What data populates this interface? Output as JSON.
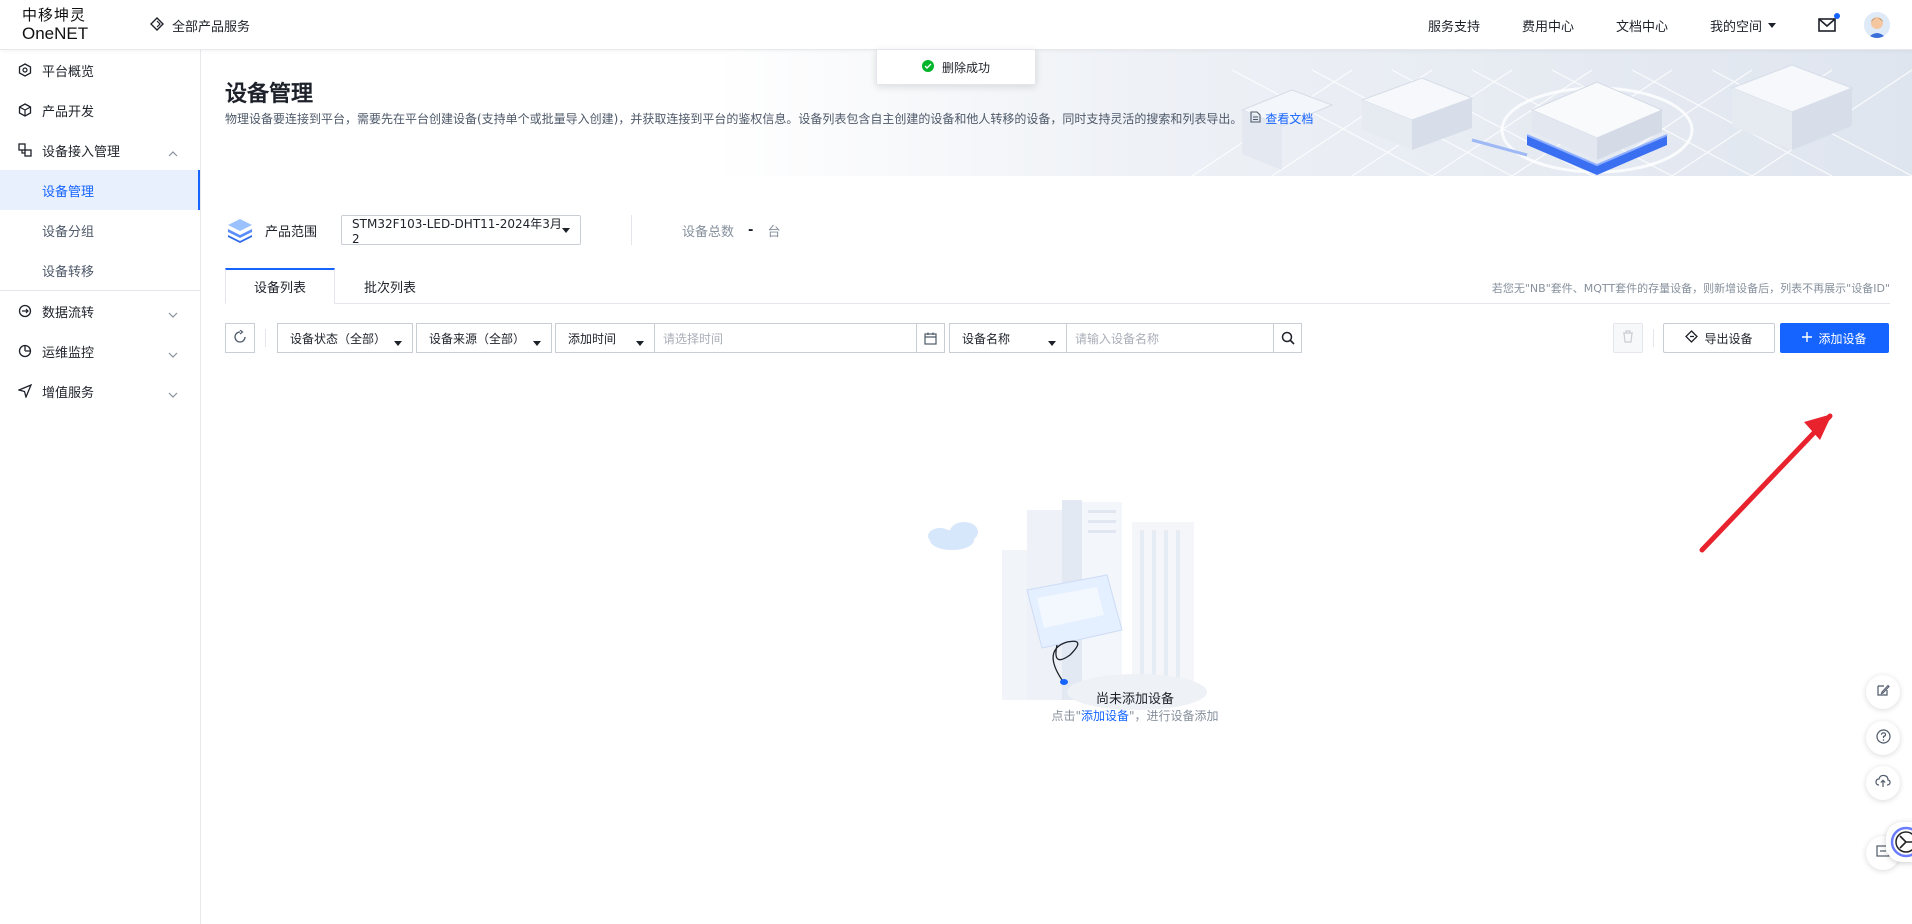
{
  "header": {
    "logo_line1": "中移坤灵",
    "logo_line2": "OneNET",
    "all_products": "全部产品服务",
    "links": [
      "服务支持",
      "费用中心",
      "文档中心"
    ],
    "my_space": "我的空间"
  },
  "sidebar": {
    "items": [
      {
        "label": "平台概览",
        "icon": "overview-icon"
      },
      {
        "label": "产品开发",
        "icon": "box-icon"
      },
      {
        "label": "设备接入管理",
        "icon": "device-access-icon"
      },
      {
        "label": "数据流转",
        "icon": "data-flow-icon"
      },
      {
        "label": "运维监控",
        "icon": "monitor-icon"
      },
      {
        "label": "增值服务",
        "icon": "send-icon"
      }
    ],
    "sub_items": [
      "设备管理",
      "设备分组",
      "设备转移"
    ]
  },
  "toast": {
    "text": "删除成功",
    "status_color": "#00b42a"
  },
  "hero": {
    "title": "设备管理",
    "description": "物理设备要连接到平台，需要先在平台创建设备(支持单个或批量导入创建)，并获取连接到平台的鉴权信息。设备列表包含自主创建的设备和他人转移的设备，同时支持灵活的搜索和列表导出。",
    "doc_link": "查看文档"
  },
  "scope": {
    "label": "产品范围",
    "product": "STM32F103-LED-DHT11-2024年3月2",
    "count_label": "设备总数",
    "count_value": "-",
    "count_unit": "台"
  },
  "tabs": {
    "items": [
      "设备列表",
      "批次列表"
    ],
    "note": "若您无\"NB\"套件、MQTT套件的存量设备，则新增设备后，列表不再展示\"设备ID\""
  },
  "filters": {
    "status": "设备状态（全部）",
    "source": "设备来源（全部）",
    "time_field": "添加时间",
    "time_placeholder": "请选择时间",
    "name_field": "设备名称",
    "name_placeholder": "请输入设备名称",
    "export_label": "导出设备",
    "add_label": "添加设备"
  },
  "empty": {
    "title": "尚未添加设备",
    "sub_prefix": "点击\"",
    "sub_link": "添加设备",
    "sub_suffix": "\"，进行设备添加"
  },
  "colors": {
    "primary": "#1664ff",
    "annotation_arrow": "#e8232e"
  }
}
